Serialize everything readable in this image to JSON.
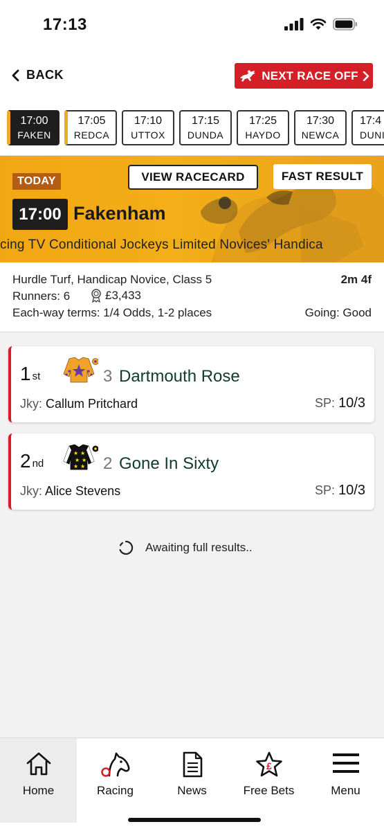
{
  "status_bar": {
    "time": "17:13"
  },
  "top_nav": {
    "back_label": "BACK",
    "next_race_label": "NEXT RACE OFF"
  },
  "race_tabs": [
    {
      "time": "17:00",
      "course": "FAKEN",
      "active": true
    },
    {
      "time": "17:05",
      "course": "REDCA",
      "active": false
    },
    {
      "time": "17:10",
      "course": "UTTOX",
      "active": false
    },
    {
      "time": "17:15",
      "course": "DUNDA",
      "active": false
    },
    {
      "time": "17:25",
      "course": "HAYDO",
      "active": false
    },
    {
      "time": "17:30",
      "course": "NEWCA",
      "active": false
    },
    {
      "time": "17:4",
      "course": "DUNI",
      "active": false
    }
  ],
  "banner": {
    "day_badge": "TODAY",
    "view_racecard_label": "VIEW RACECARD",
    "fast_result_label": "FAST RESULT",
    "race_time": "17:00",
    "course": "Fakenham",
    "race_title": "cing TV Conditional Jockeys Limited Novices' Handica"
  },
  "race_info": {
    "description": "Hurdle Turf, Handicap Novice, Class 5",
    "distance": "2m 4f",
    "runners": "Runners: 6",
    "prize": "£3,433",
    "each_way": "Each-way terms: 1/4 Odds, 1-2 places",
    "going": "Going: Good"
  },
  "results": [
    {
      "position": "1",
      "suffix": "st",
      "number": "3",
      "horse": "Dartmouth Rose",
      "jockey_label": "Jky:",
      "jockey": "Callum Pritchard",
      "sp_label": "SP:",
      "sp": "10/3"
    },
    {
      "position": "2",
      "suffix": "nd",
      "number": "2",
      "horse": "Gone In Sixty",
      "jockey_label": "Jky:",
      "jockey": "Alice Stevens",
      "sp_label": "SP:",
      "sp": "10/3"
    }
  ],
  "awaiting_text": "Awaiting full results..",
  "bottom_nav": [
    {
      "label": "Home",
      "icon": "home-icon",
      "active": true
    },
    {
      "label": "Racing",
      "icon": "horse-head-icon",
      "active": false
    },
    {
      "label": "News",
      "icon": "document-icon",
      "active": false
    },
    {
      "label": "Free Bets",
      "icon": "star-pound-icon",
      "active": false
    },
    {
      "label": "Menu",
      "icon": "hamburger-icon",
      "active": false
    }
  ],
  "colors": {
    "brand_red": "#d51f26",
    "banner_amber": "#f1a713",
    "accent_gold": "#f0a92a",
    "horse_name_green": "#103a33"
  }
}
